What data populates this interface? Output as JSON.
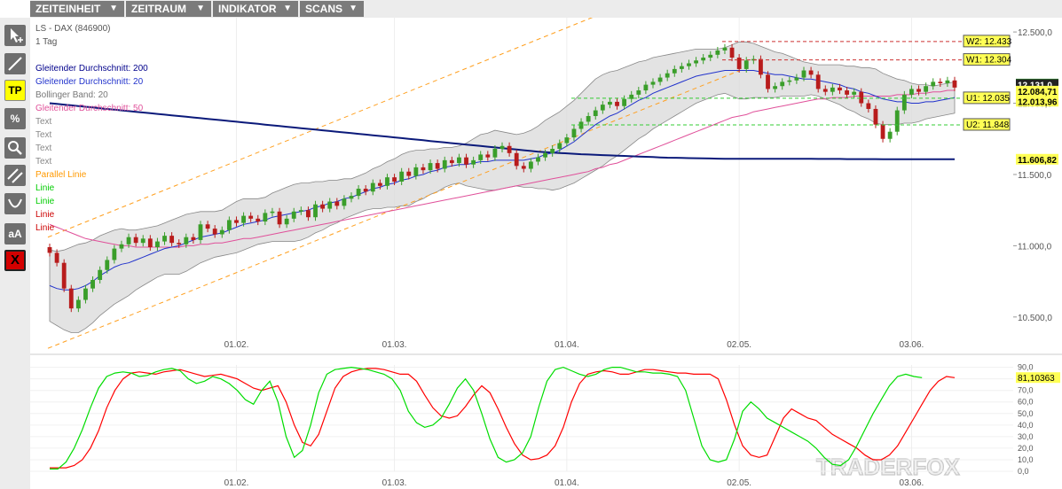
{
  "menu": {
    "items": [
      {
        "label": "ZEITEINHEIT",
        "arrow": "▼"
      },
      {
        "label": "ZEITRAUM",
        "arrow": "▼"
      },
      {
        "label": "INDIKATOR",
        "arrow": "▼"
      },
      {
        "label": "SCANS",
        "arrow": "▼"
      }
    ]
  },
  "toolbar": {
    "tools": [
      {
        "icon": "cursor-icon"
      },
      {
        "icon": "line-icon"
      },
      {
        "icon": "tp-icon",
        "label": "TP"
      },
      {
        "icon": "percent-icon",
        "label": "%"
      },
      {
        "icon": "zoom-icon"
      },
      {
        "icon": "parallel-icon"
      },
      {
        "icon": "arc-icon"
      },
      {
        "icon": "text-size-icon",
        "label": "aA"
      },
      {
        "icon": "delete-icon",
        "label": "X"
      }
    ]
  },
  "watermark": "TRADERFOX",
  "chart_data": [
    {
      "type": "candlestick",
      "title": "LS - DAX (846900)",
      "subtitle": "1 Tag",
      "legend": [
        {
          "label": "Gleitender Durchschnitt: 200",
          "color": "#00008b"
        },
        {
          "label": "Gleitender Durchschnitt: 20",
          "color": "#2233cc"
        },
        {
          "label": "Bollinger Band: 20",
          "color": "#777777"
        },
        {
          "label": "Gleitender Durchschnitt: 50",
          "color": "#e0509a"
        },
        {
          "label": "Text",
          "color": "#888888"
        },
        {
          "label": "Text",
          "color": "#888888"
        },
        {
          "label": "Text",
          "color": "#888888"
        },
        {
          "label": "Text",
          "color": "#888888"
        },
        {
          "label": "Parallel Linie",
          "color": "#ff9900"
        },
        {
          "label": "Linie",
          "color": "#00cc00"
        },
        {
          "label": "Linie",
          "color": "#00cc00"
        },
        {
          "label": "Linie",
          "color": "#cc0000"
        },
        {
          "label": "Linie",
          "color": "#cc0000"
        }
      ],
      "y_ticks": [
        "12.500,0",
        "12.000,0",
        "11.500,0",
        "11.000,0",
        "10.500,0"
      ],
      "y_tick_values": [
        12500,
        12000,
        11500,
        11000,
        10500
      ],
      "ylim": [
        10300,
        12600
      ],
      "x_ticks": [
        "01.02.",
        "01.03.",
        "01.04.",
        "02.05.",
        "03.06."
      ],
      "close": [
        10950,
        10880,
        10700,
        10560,
        10620,
        10700,
        10760,
        10830,
        10900,
        10980,
        11010,
        11060,
        11020,
        11050,
        10990,
        11030,
        11070,
        11020,
        11010,
        11060,
        11040,
        11150,
        11120,
        11080,
        11110,
        11180,
        11160,
        11210,
        11190,
        11170,
        11230,
        11240,
        11150,
        11190,
        11240,
        11250,
        11200,
        11290,
        11260,
        11310,
        11280,
        11330,
        11350,
        11400,
        11380,
        11440,
        11420,
        11480,
        11450,
        11520,
        11490,
        11550,
        11530,
        11580,
        11540,
        11600,
        11580,
        11620,
        11570,
        11600,
        11640,
        11620,
        11680,
        11700,
        11650,
        11560,
        11540,
        11590,
        11620,
        11650,
        11680,
        11720,
        11760,
        11820,
        11870,
        11910,
        11950,
        11990,
        12010,
        11980,
        12030,
        12060,
        12090,
        12130,
        12150,
        12180,
        12210,
        12240,
        12260,
        12280,
        12300,
        12320,
        12340,
        12370,
        12390,
        12320,
        12240,
        12300,
        12310,
        12200,
        12100,
        12120,
        12150,
        12160,
        12180,
        12230,
        12200,
        12100,
        12080,
        12110,
        12090,
        12060,
        12080,
        12000,
        11960,
        11850,
        11750,
        11800,
        11950,
        12060,
        12100,
        12080,
        12120,
        12150,
        12140,
        12160,
        12110
      ],
      "ma20": [
        10720,
        10700,
        10690,
        10690,
        10700,
        10720,
        10750,
        10790,
        10820,
        10850,
        10870,
        10880,
        10900,
        10920,
        10940,
        10960,
        10980,
        10990,
        11000,
        11020,
        11040,
        11060,
        11070,
        11080,
        11090,
        11110,
        11130,
        11150,
        11160,
        11170,
        11180,
        11200,
        11210,
        11220,
        11230,
        11240,
        11250,
        11270,
        11280,
        11300,
        11310,
        11330,
        11340,
        11360,
        11380,
        11400,
        11410,
        11430,
        11440,
        11460,
        11470,
        11490,
        11500,
        11520,
        11530,
        11550,
        11560,
        11570,
        11570,
        11580,
        11590,
        11590,
        11600,
        11600,
        11600,
        11600,
        11600,
        11610,
        11620,
        11640,
        11650,
        11670,
        11700,
        11730,
        11770,
        11810,
        11850,
        11880,
        11910,
        11930,
        11960,
        11990,
        12020,
        12040,
        12070,
        12090,
        12110,
        12130,
        12150,
        12170,
        12190,
        12200,
        12210,
        12220,
        12230,
        12230,
        12230,
        12230,
        12230,
        12220,
        12210,
        12200,
        12200,
        12190,
        12180,
        12170,
        12170,
        12160,
        12150,
        12140,
        12130,
        12110,
        12100,
        12080,
        12070,
        12050,
        12030,
        12020,
        12010,
        12010,
        12000,
        12000,
        12010,
        12010,
        12020,
        12030,
        12040
      ],
      "ma50": [
        11150,
        11130,
        11110,
        11090,
        11070,
        11050,
        11040,
        11030,
        11020,
        11010,
        11000,
        11000,
        10990,
        10990,
        10990,
        10990,
        10990,
        10990,
        10990,
        11000,
        11000,
        11010,
        11010,
        11020,
        11020,
        11030,
        11040,
        11050,
        11050,
        11060,
        11070,
        11080,
        11090,
        11100,
        11110,
        11120,
        11130,
        11140,
        11150,
        11160,
        11170,
        11180,
        11190,
        11200,
        11210,
        11220,
        11230,
        11240,
        11250,
        11260,
        11270,
        11280,
        11290,
        11300,
        11310,
        11320,
        11330,
        11340,
        11350,
        11360,
        11370,
        11380,
        11390,
        11400,
        11410,
        11420,
        11430,
        11440,
        11450,
        11460,
        11470,
        11480,
        11490,
        11500,
        11510,
        11520,
        11540,
        11550,
        11570,
        11580,
        11600,
        11620,
        11640,
        11660,
        11680,
        11700,
        11720,
        11740,
        11760,
        11780,
        11800,
        11820,
        11840,
        11860,
        11880,
        11900,
        11910,
        11920,
        11940,
        11950,
        11960,
        11970,
        11980,
        11990,
        12000,
        12010,
        12020,
        12030,
        12030,
        12040,
        12040,
        12040,
        12050,
        12050,
        12050,
        12050,
        12050,
        12050,
        12060,
        12060,
        12060,
        12070,
        12070,
        12080,
        12080,
        12090,
        12090
      ],
      "ma200": [
        12000,
        11995,
        11990,
        11985,
        11980,
        11975,
        11970,
        11965,
        11960,
        11955,
        11950,
        11945,
        11940,
        11935,
        11930,
        11925,
        11920,
        11915,
        11910,
        11905,
        11900,
        11895,
        11890,
        11885,
        11880,
        11875,
        11870,
        11865,
        11860,
        11855,
        11850,
        11845,
        11840,
        11835,
        11830,
        11825,
        11820,
        11815,
        11810,
        11805,
        11800,
        11795,
        11790,
        11785,
        11780,
        11775,
        11770,
        11765,
        11760,
        11755,
        11750,
        11745,
        11740,
        11735,
        11730,
        11725,
        11720,
        11715,
        11710,
        11705,
        11700,
        11695,
        11690,
        11685,
        11680,
        11675,
        11670,
        11665,
        11660,
        11657,
        11654,
        11651,
        11648,
        11645,
        11642,
        11640,
        11638,
        11636,
        11634,
        11632,
        11630,
        11628,
        11626,
        11624,
        11622,
        11620,
        11618,
        11617,
        11616,
        11615,
        11614,
        11613,
        11612,
        11611,
        11610,
        11610,
        11610,
        11610,
        11610,
        11610,
        11610,
        11610,
        11610,
        11610,
        11610,
        11610,
        11610,
        11609,
        11609,
        11609,
        11609,
        11608,
        11608,
        11608,
        11608,
        11608,
        11607,
        11607,
        11607,
        11607,
        11607,
        11607,
        11607,
        11607,
        11607,
        11607,
        11607
      ],
      "bb_width": [
        250,
        260,
        280,
        300,
        310,
        300,
        290,
        280,
        270,
        260,
        250,
        230,
        210,
        200,
        190,
        180,
        180,
        190,
        200,
        200,
        190,
        180,
        170,
        160,
        160,
        170,
        180,
        180,
        170,
        160,
        160,
        170,
        180,
        190,
        200,
        200,
        190,
        180,
        170,
        160,
        150,
        140,
        130,
        130,
        130,
        140,
        150,
        160,
        170,
        180,
        190,
        180,
        170,
        160,
        150,
        140,
        130,
        130,
        150,
        170,
        190,
        200,
        210,
        200,
        190,
        180,
        190,
        200,
        220,
        240,
        260,
        270,
        280,
        290,
        300,
        310,
        320,
        320,
        310,
        300,
        290,
        280,
        270,
        260,
        250,
        240,
        230,
        220,
        210,
        200,
        190,
        180,
        170,
        160,
        160,
        180,
        200,
        200,
        190,
        180,
        170,
        160,
        150,
        140,
        130,
        120,
        110,
        110,
        120,
        130,
        140,
        150,
        160,
        170,
        180,
        190,
        180,
        170,
        160,
        150,
        140,
        130,
        120,
        110,
        110,
        110,
        110
      ],
      "annotations": [
        {
          "label": "W2: 12.433",
          "value": 12433,
          "style": "resistance"
        },
        {
          "label": "W1: 12.304",
          "value": 12304,
          "style": "resistance"
        },
        {
          "label": "U1: 12.035",
          "value": 12035,
          "style": "support"
        },
        {
          "label": "U2: 11.848",
          "value": 11848,
          "style": "support"
        }
      ],
      "price_labels": [
        {
          "label": "12.134,5",
          "value": 12134.5,
          "color": "#2ea02e"
        },
        {
          "label": "12.131,0",
          "value": 12131,
          "color": "#222222"
        },
        {
          "label": "12.084,71",
          "value": 12084.71,
          "color": "#ffff55"
        },
        {
          "label": "12.013,96",
          "value": 12013.96,
          "color": "#ffff55"
        },
        {
          "label": "11.606,82",
          "value": 11606.82,
          "color": "#ffff55"
        }
      ],
      "channel": {
        "lower_start": 10280,
        "lower_end": 12230,
        "upper_start": 11060,
        "upper_end": 13020
      }
    },
    {
      "type": "line",
      "title": "",
      "y_ticks": [
        "90,0",
        "80,0",
        "70,0",
        "60,0",
        "50,0",
        "40,0",
        "30,0",
        "20,0",
        "10,0",
        "0,0"
      ],
      "y_tick_values": [
        90,
        80,
        70,
        60,
        50,
        40,
        30,
        20,
        10,
        0
      ],
      "ylim": [
        0,
        92
      ],
      "x_ticks": [
        "01.02.",
        "01.03.",
        "01.04.",
        "02.05.",
        "03.06."
      ],
      "value_label": "81,10363",
      "series": [
        {
          "color": "#ff0000",
          "values": [
            3,
            3,
            3,
            5,
            10,
            20,
            35,
            55,
            70,
            80,
            85,
            86,
            85,
            84,
            86,
            87,
            88,
            86,
            84,
            82,
            83,
            84,
            82,
            80,
            76,
            72,
            70,
            72,
            74,
            60,
            40,
            25,
            22,
            32,
            52,
            72,
            82,
            86,
            88,
            89,
            89,
            88,
            86,
            84,
            84,
            78,
            66,
            55,
            48,
            46,
            48,
            56,
            66,
            74,
            68,
            54,
            38,
            24,
            14,
            10,
            11,
            14,
            22,
            38,
            60,
            76,
            84,
            86,
            87,
            86,
            84,
            84,
            86,
            88,
            88,
            87,
            86,
            85,
            85,
            84,
            84,
            84,
            80,
            62,
            40,
            22,
            14,
            12,
            14,
            30,
            46,
            54,
            50,
            46,
            44,
            38,
            32,
            28,
            24,
            20,
            14,
            10,
            10,
            14,
            22,
            34,
            46,
            58,
            70,
            78,
            82,
            81
          ]
        },
        {
          "color": "#00dd00",
          "values": [
            2,
            2,
            8,
            20,
            36,
            55,
            72,
            82,
            85,
            86,
            85,
            82,
            83,
            86,
            88,
            89,
            87,
            80,
            76,
            78,
            82,
            80,
            76,
            70,
            62,
            58,
            70,
            78,
            60,
            30,
            12,
            18,
            40,
            68,
            84,
            88,
            89,
            90,
            89,
            88,
            86,
            84,
            80,
            70,
            52,
            42,
            38,
            40,
            46,
            58,
            72,
            80,
            70,
            50,
            28,
            12,
            8,
            10,
            16,
            30,
            56,
            78,
            88,
            90,
            87,
            84,
            82,
            84,
            88,
            90,
            90,
            88,
            86,
            86,
            85,
            85,
            84,
            82,
            70,
            46,
            22,
            10,
            8,
            10,
            28,
            52,
            60,
            54,
            46,
            42,
            38,
            34,
            30,
            26,
            20,
            12,
            6,
            5,
            10,
            22,
            36,
            50,
            62,
            74,
            82,
            84,
            82,
            81
          ]
        }
      ]
    }
  ]
}
